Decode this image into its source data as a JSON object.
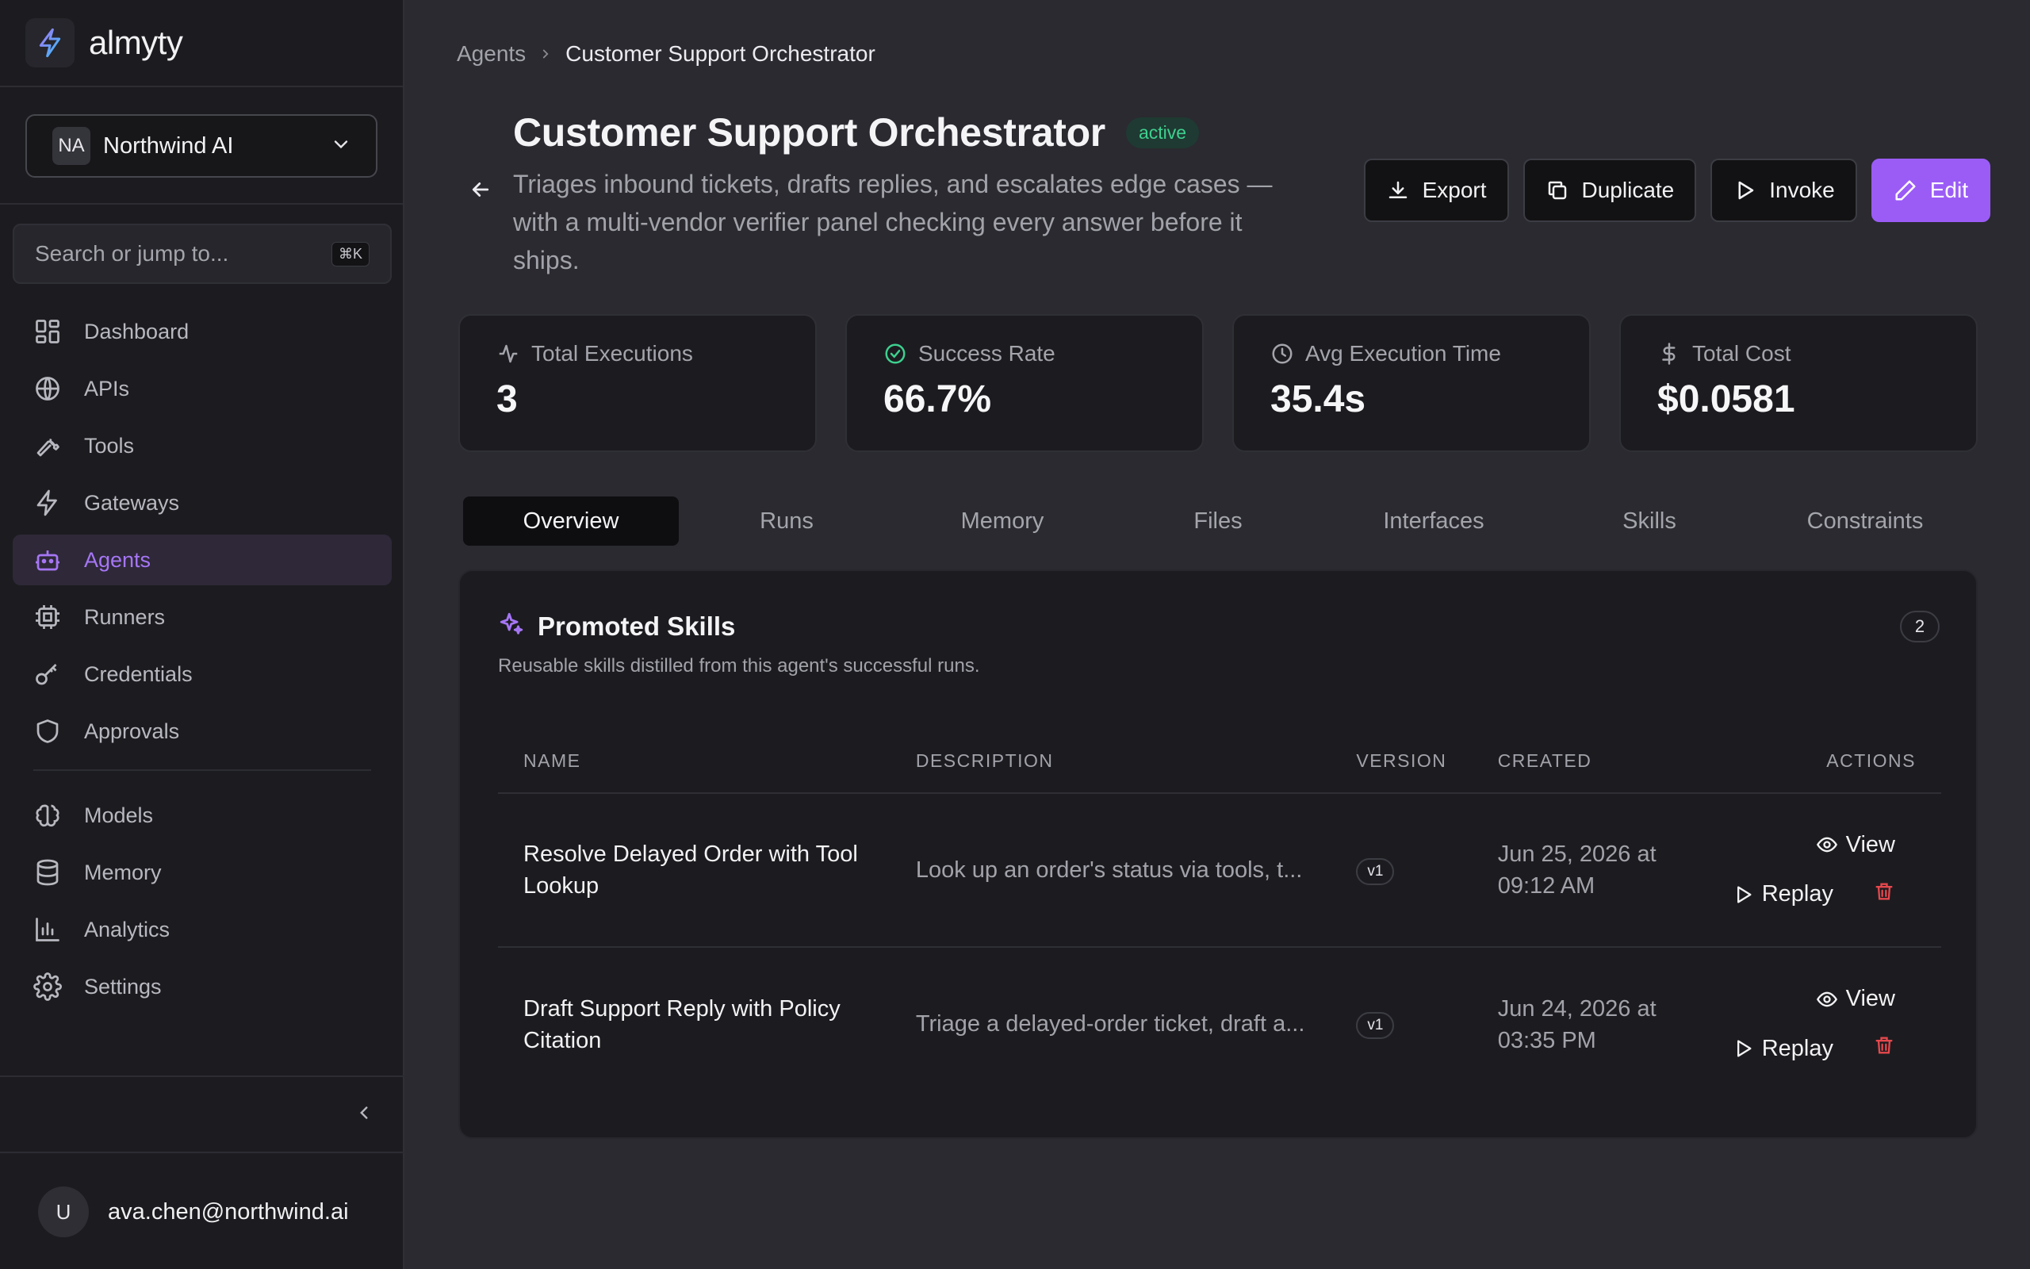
{
  "brand": {
    "name": "almyty"
  },
  "org": {
    "initials": "NA",
    "name": "Northwind AI"
  },
  "search": {
    "placeholder": "Search or jump to...",
    "shortcut": "⌘K"
  },
  "nav": {
    "primary": [
      {
        "label": "Dashboard",
        "icon": "dashboard-icon"
      },
      {
        "label": "APIs",
        "icon": "globe-icon"
      },
      {
        "label": "Tools",
        "icon": "wrench-icon"
      },
      {
        "label": "Gateways",
        "icon": "lightning-icon"
      },
      {
        "label": "Agents",
        "icon": "bot-icon",
        "active": true
      },
      {
        "label": "Runners",
        "icon": "cpu-icon"
      },
      {
        "label": "Credentials",
        "icon": "key-icon"
      },
      {
        "label": "Approvals",
        "icon": "shield-icon"
      }
    ],
    "secondary": [
      {
        "label": "Models",
        "icon": "brain-icon"
      },
      {
        "label": "Memory",
        "icon": "database-icon"
      },
      {
        "label": "Analytics",
        "icon": "bar-chart-icon"
      },
      {
        "label": "Settings",
        "icon": "gear-icon"
      }
    ]
  },
  "user": {
    "initial": "U",
    "email": "ava.chen@northwind.ai"
  },
  "breadcrumb": {
    "parent": "Agents",
    "current": "Customer Support Orchestrator"
  },
  "agent": {
    "title": "Customer Support Orchestrator",
    "status": "active",
    "description": "Triages inbound tickets, drafts replies, and escalates edge cases — with a multi-vendor verifier panel checking every answer before it ships."
  },
  "actions": {
    "export": "Export",
    "duplicate": "Duplicate",
    "invoke": "Invoke",
    "edit": "Edit"
  },
  "stats": [
    {
      "label": "Total Executions",
      "value": "3",
      "icon": "activity-icon"
    },
    {
      "label": "Success Rate",
      "value": "66.7%",
      "icon": "check-circle-icon"
    },
    {
      "label": "Avg Execution Time",
      "value": "35.4s",
      "icon": "clock-icon"
    },
    {
      "label": "Total Cost",
      "value": "$0.0581",
      "icon": "dollar-icon"
    }
  ],
  "tabs": [
    "Overview",
    "Runs",
    "Memory",
    "Files",
    "Interfaces",
    "Skills",
    "Constraints"
  ],
  "active_tab": "Overview",
  "skills": {
    "title": "Promoted Skills",
    "subtitle": "Reusable skills distilled from this agent's successful runs.",
    "count": "2",
    "columns": [
      "NAME",
      "DESCRIPTION",
      "VERSION",
      "CREATED",
      "ACTIONS"
    ],
    "rows": [
      {
        "name": "Resolve Delayed Order with Tool Lookup",
        "description": "Look up an order's status via tools, t...",
        "version": "v1",
        "created": "Jun 25, 2026 at 09:12 AM"
      },
      {
        "name": "Draft Support Reply with Policy Citation",
        "description": "Triage a delayed-order ticket, draft a...",
        "version": "v1",
        "created": "Jun 24, 2026 at 03:35 PM"
      }
    ],
    "view_label": "View",
    "replay_label": "Replay"
  },
  "colors": {
    "accent": "#9b5cf6",
    "active_nav": "#a676f5",
    "success": "#3ed08f",
    "danger": "#e5484d"
  }
}
